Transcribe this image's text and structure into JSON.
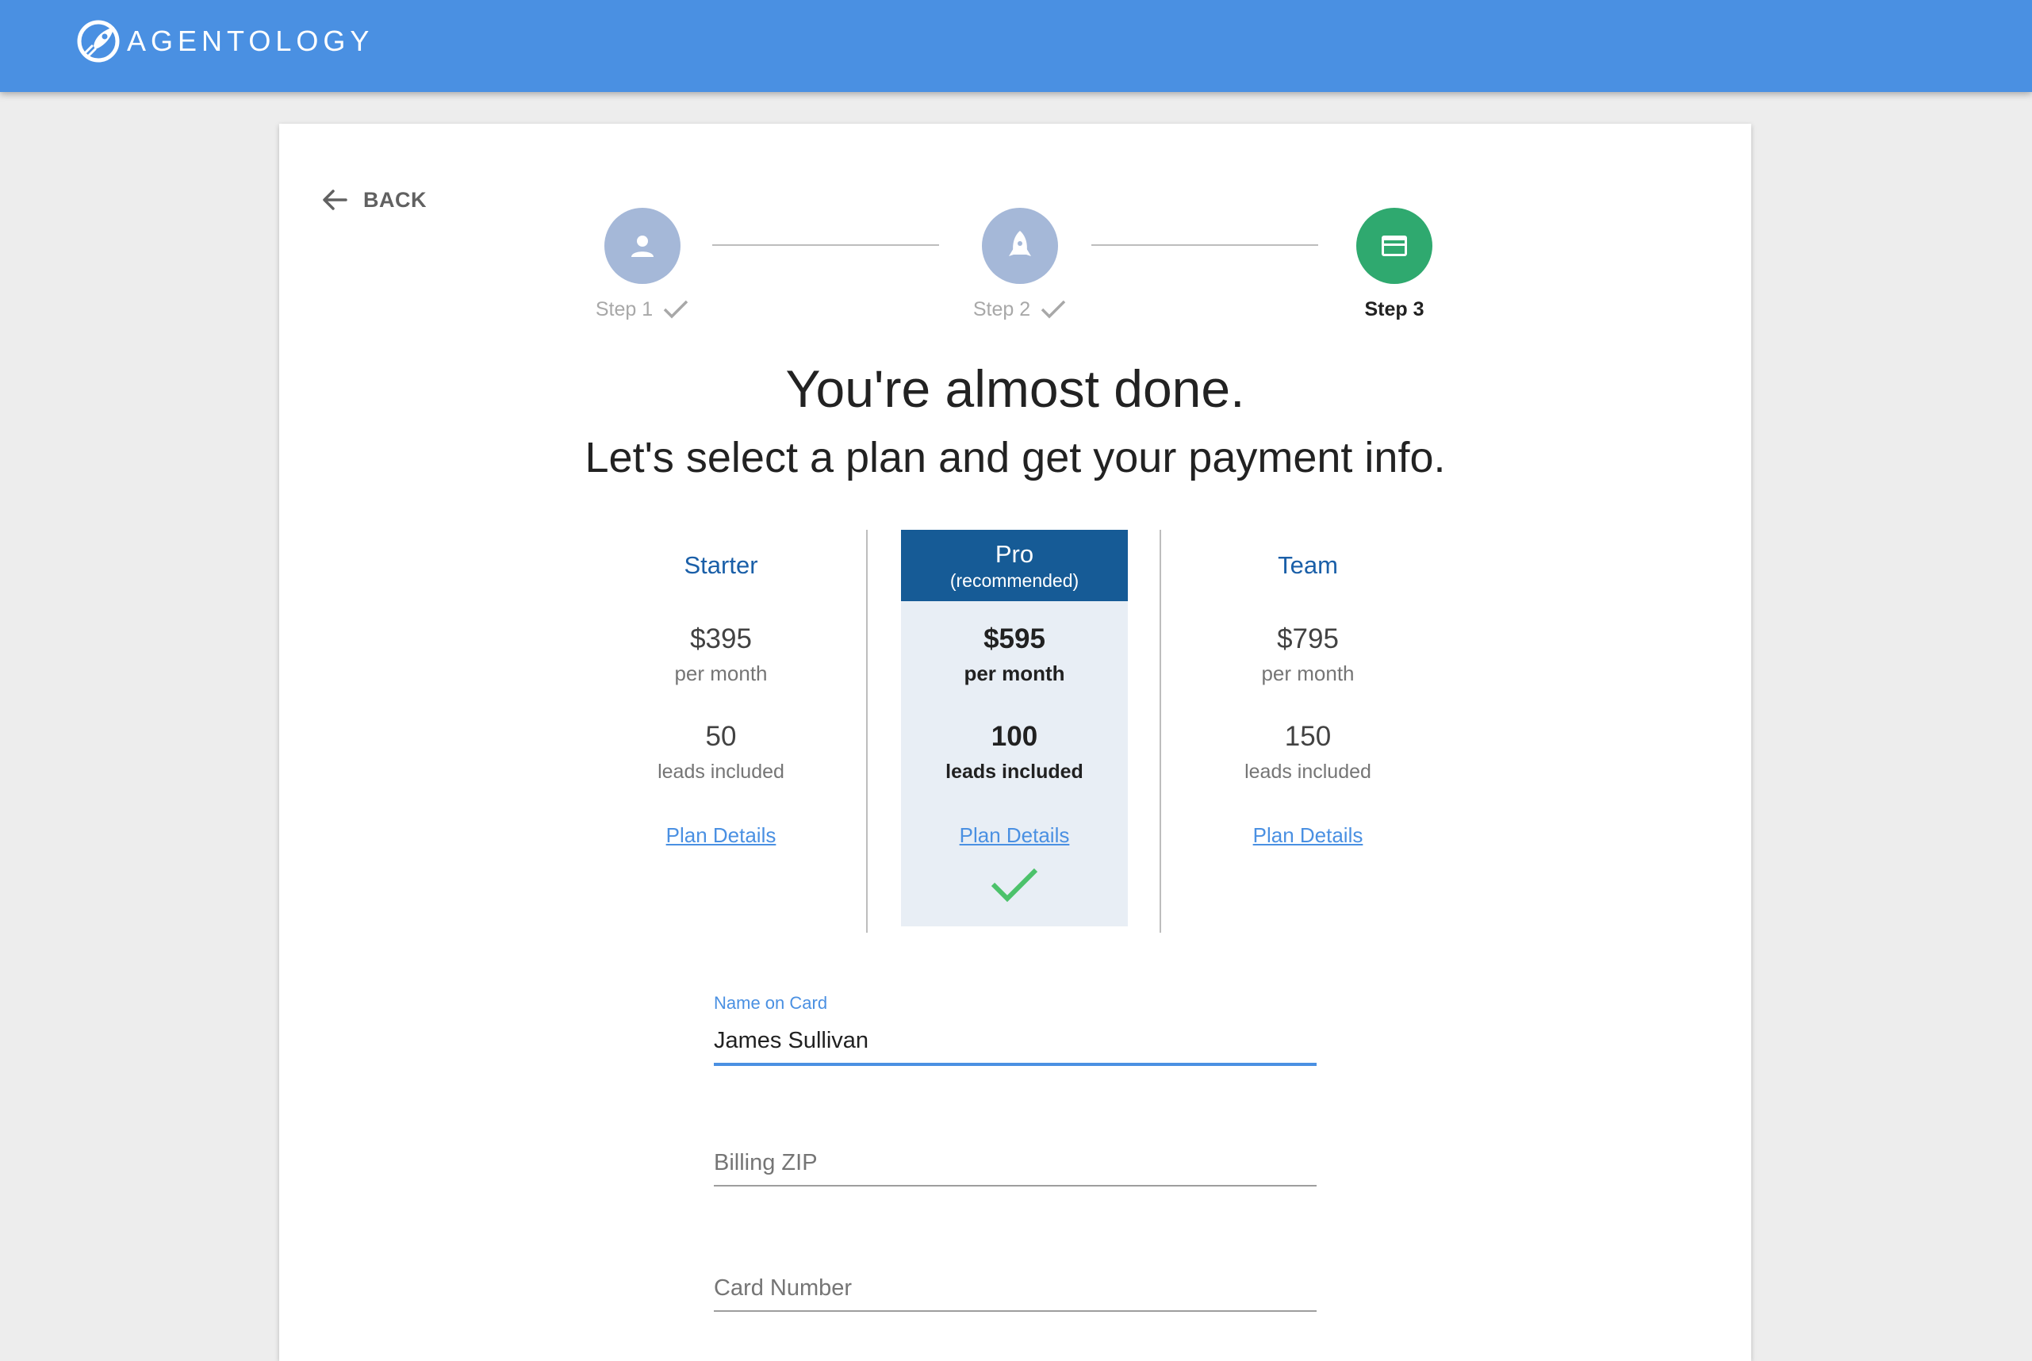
{
  "header": {
    "brand_name": "AGENTOLOGY",
    "color": "#4a90e2"
  },
  "nav": {
    "back_label": "BACK"
  },
  "stepper": {
    "steps": [
      {
        "label": "Step 1",
        "status": "completed",
        "icon": "person-icon"
      },
      {
        "label": "Step 2",
        "status": "completed",
        "icon": "rocket-icon"
      },
      {
        "label": "Step 3",
        "status": "active",
        "icon": "credit-card-icon"
      }
    ],
    "completed_color": "#a5b8d8",
    "active_color": "#2fa96f"
  },
  "heading": {
    "title": "You're almost done.",
    "subtitle": "Let's select a plan and get your payment info."
  },
  "plans": [
    {
      "name": "Starter",
      "price": "$395",
      "period": "per month",
      "leads": "50",
      "leads_label": "leads included",
      "link": "Plan Details",
      "selected": false
    },
    {
      "name": "Pro",
      "tag": "(recommended)",
      "price": "$595",
      "period": "per month",
      "leads": "100",
      "leads_label": "leads included",
      "link": "Plan Details",
      "selected": true
    },
    {
      "name": "Team",
      "price": "$795",
      "period": "per month",
      "leads": "150",
      "leads_label": "leads included",
      "link": "Plan Details",
      "selected": false
    }
  ],
  "form": {
    "name_on_card": {
      "label": "Name on Card",
      "value": "James Sullivan"
    },
    "billing_zip": {
      "placeholder": "Billing ZIP"
    },
    "card_number": {
      "placeholder": "Card Number"
    }
  }
}
